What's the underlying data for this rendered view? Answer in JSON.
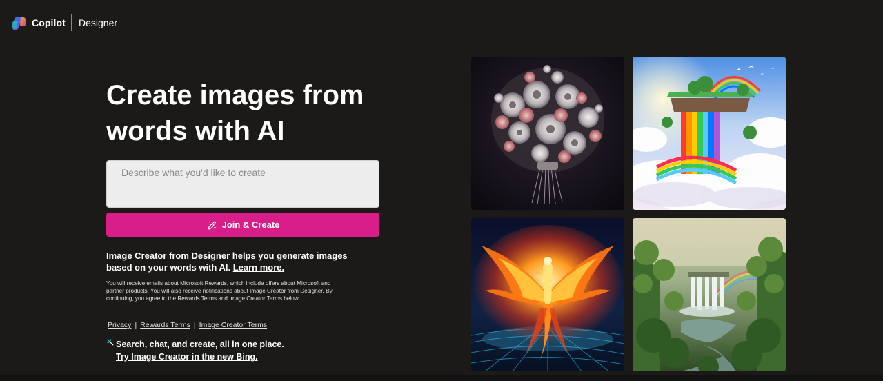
{
  "header": {
    "brand": "Copilot",
    "product": "Designer"
  },
  "hero": {
    "title": "Create images from words with AI"
  },
  "prompt": {
    "placeholder": "Describe what you'd like to create",
    "value": ""
  },
  "join_button": {
    "label": "Join & Create"
  },
  "description": {
    "text": "Image Creator from Designer helps you generate images based on your words with AI.",
    "link": "Learn more."
  },
  "fine_print": "You will receive emails about Microsoft Rewards, which include offers about Microsoft and partner products. You will also receive notifications about Image Creator from Designer. By continuing, you agree to the Rewards Terms and Image Creator Terms below.",
  "legal_links": {
    "privacy": "Privacy",
    "separator": "|",
    "rewards_terms": "Rewards Terms",
    "image_creator_terms": "Image Creator Terms"
  },
  "promo": {
    "text": "Search, chat, and create, all in one place.",
    "link": "Try Image Creator in the new Bing."
  },
  "gallery": [
    {
      "name": "flower-bouquet-image",
      "icon": "image"
    },
    {
      "name": "rainbow-waterfall-clouds-image",
      "icon": "image"
    },
    {
      "name": "fire-phoenix-image",
      "icon": "image"
    },
    {
      "name": "jungle-waterfall-image",
      "icon": "image"
    }
  ],
  "colors": {
    "background": "#1b1a19",
    "accent_button": "#d91d89",
    "input_background": "#ededed"
  }
}
